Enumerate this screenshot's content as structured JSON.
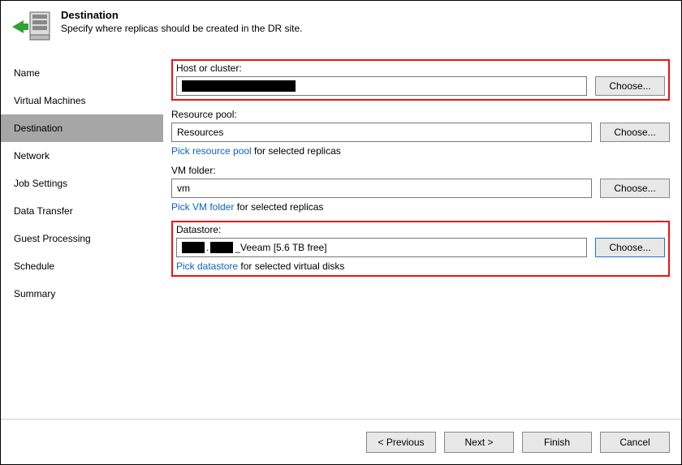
{
  "header": {
    "title": "Destination",
    "subtitle": "Specify where replicas should be created in the DR site."
  },
  "sidebar": {
    "items": [
      {
        "label": "Name"
      },
      {
        "label": "Virtual Machines"
      },
      {
        "label": "Destination"
      },
      {
        "label": "Network"
      },
      {
        "label": "Job Settings"
      },
      {
        "label": "Data Transfer"
      },
      {
        "label": "Guest Processing"
      },
      {
        "label": "Schedule"
      },
      {
        "label": "Summary"
      }
    ],
    "selected_index": 2
  },
  "fields": {
    "host": {
      "label": "Host or cluster:",
      "value_is_redacted": true,
      "value": "",
      "choose": "Choose..."
    },
    "resource_pool": {
      "label": "Resource pool:",
      "value": "Resources",
      "choose": "Choose...",
      "link": "Pick resource pool",
      "link_suffix": "  for selected replicas"
    },
    "vm_folder": {
      "label": "VM folder:",
      "value": "vm",
      "choose": "Choose...",
      "link": "Pick VM folder",
      "link_suffix": "  for selected replicas"
    },
    "datastore": {
      "label": "Datastore:",
      "value_prefix_redacted": true,
      "value": "_Veeam [5.6 TB free]",
      "choose": "Choose...",
      "link": "Pick datastore",
      "link_suffix": "  for selected virtual disks"
    }
  },
  "footer": {
    "previous": "< Previous",
    "next": "Next >",
    "finish": "Finish",
    "cancel": "Cancel"
  }
}
